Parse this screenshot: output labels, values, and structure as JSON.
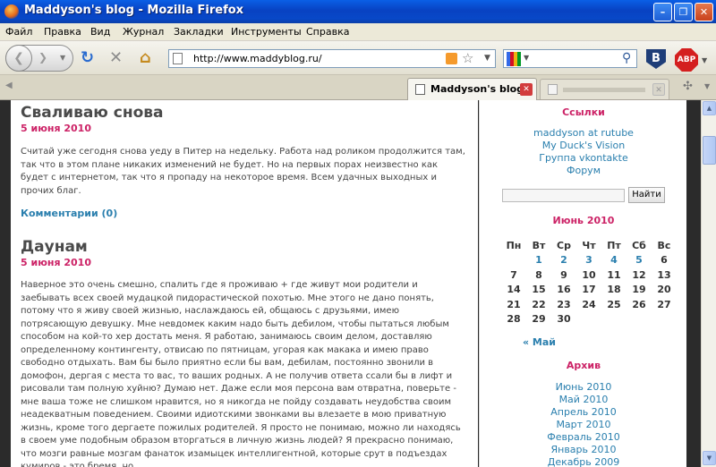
{
  "window": {
    "title": "Maddyson's blog - Mozilla Firefox",
    "minimize_label": "–",
    "maximize_label": "❐",
    "close_label": "✕"
  },
  "menu": [
    "Файл",
    "Правка",
    "Вид",
    "Журнал",
    "Закладки",
    "Инструменты",
    "Справка"
  ],
  "toolbar": {
    "url": "http://www.maddyblog.ru/",
    "search_value": "",
    "abp_label": "ABP",
    "v_label": "В"
  },
  "icons": {
    "back": "back-arrow-icon",
    "forward": "forward-arrow-icon",
    "reload": "reload-icon",
    "stop": "stop-icon",
    "home": "home-icon",
    "rss": "rss-feed-icon",
    "bookmark": "bookmark-star-icon",
    "search_engine": "google-icon",
    "search": "magnifier-icon",
    "tab_close": "close-icon"
  },
  "tabs": [
    {
      "label": "Maddyson's blog",
      "active": true
    },
    {
      "label": "",
      "active": false
    }
  ],
  "posts": [
    {
      "title": "Сваливаю снова",
      "date": "5 июня 2010",
      "body": "Считай уже сегодня снова уеду в Питер на недельку. Работа над роликом продолжится там, так что в этом плане никаких изменений не будет. Но на первых порах неизвестно как будет с интернетом, так что я пропаду на некоторое время. Всем удачных выходных и прочих благ.",
      "comments": "Комментарии (0)"
    },
    {
      "title": "Даунам",
      "date": "5 июня 2010",
      "body": "Наверное это очень смешно, спалить где я проживаю + где живут мои родители и заебывать всех своей мудацкой пидорастической похотью. Мне этого не дано понять, потому что я живу своей жизнью, наслаждаюсь ей, общаюсь с друзьями, имею потрясающую девушку. Мне невдомек каким надо быть дебилом, чтобы пытаться любым способом на кой-то хер достать меня. Я работаю, занимаюсь своим делом, доставляю определенному контингенту, отвисаю по пятницам, угорая как макака и имею право свободно отдыхать. Вам бы было приятно если бы вам, дебилам, постоянно звонили в домофон, дергая с места то вас, то ваших родных. А не получив ответа ссали бы в лифт и рисовали там полную хуйню? Думаю нет. Даже если моя персона вам отвратна, поверьте - мне ваша тоже не слишком нравится, но я никогда не пойду создавать неудобства своим неадекватным поведением. Своими идиотскими звонками вы влезаете в мою приватную жизнь, кроме того дергаете пожилых родителей. Я просто не понимаю, можно ли находясь в своем уме подобным образом вторгаться в личную жизнь людей? Я прекрасно понимаю, что мозги равные мозгам фанаток изамыцек интеллигентной, которые срут в подъездах кумиров - это бремя, но"
    }
  ],
  "sidebar": {
    "links_heading": "Ссылки",
    "links": [
      "maddyson at rutube",
      "My Duck's Vision",
      "Группа vkontakte",
      "Форум"
    ],
    "search_button": "Найти",
    "calendar_title": "Июнь 2010",
    "calendar_days": [
      "Пн",
      "Вт",
      "Ср",
      "Чт",
      "Пт",
      "Сб",
      "Вс"
    ],
    "calendar_weeks": [
      [
        "",
        "1",
        "2",
        "3",
        "4",
        "5",
        "6"
      ],
      [
        "7",
        "8",
        "9",
        "10",
        "11",
        "12",
        "13"
      ],
      [
        "14",
        "15",
        "16",
        "17",
        "18",
        "19",
        "20"
      ],
      [
        "21",
        "22",
        "23",
        "24",
        "25",
        "26",
        "27"
      ],
      [
        "28",
        "29",
        "30",
        "",
        "",
        "",
        ""
      ]
    ],
    "calendar_linked_days": [
      "1",
      "2",
      "3",
      "4",
      "5"
    ],
    "prev_month": "« Май",
    "archive_heading": "Архив",
    "archive": [
      "Июнь 2010",
      "Май 2010",
      "Апрель 2010",
      "Март 2010",
      "Февраль 2010",
      "Январь 2010",
      "Декабрь 2009"
    ]
  },
  "colors": {
    "accent_pink": "#cc2266",
    "link_blue": "#2a7fae",
    "titlebar_blue": "#0842c2",
    "page_bg": "#2b2b2b"
  }
}
